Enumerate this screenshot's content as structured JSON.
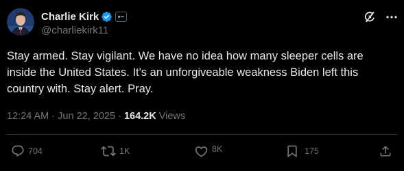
{
  "author": {
    "display_name": "Charlie Kirk",
    "handle": "@charliekirk11"
  },
  "post": {
    "lines": [
      "Stay armed. Stay vigilant. We have no idea how many sleeper cells are",
      "inside the United States. It's an unforgiveable weakness Biden left this",
      "country with. Stay alert. Pray."
    ],
    "time": "12:24 AM",
    "separator_1": "·",
    "date": "Jun 22, 2025",
    "separator_2": "·",
    "views_count": "164.2K",
    "views_label": "Views"
  },
  "actions": {
    "replies": "704",
    "reposts": "1K",
    "likes": "8K",
    "bookmarks": "175"
  },
  "icons": {
    "verified": "verified-badge-icon",
    "affiliation": "affiliation-badge-icon",
    "grok": "grok-icon",
    "more": "more-options-icon",
    "reply": "reply-icon",
    "repost": "repost-icon",
    "like": "heart-icon",
    "bookmark": "bookmark-icon",
    "share": "share-icon"
  },
  "colors": {
    "background": "#000000",
    "text_primary": "#e7e9ea",
    "text_secondary": "#71767b",
    "verified_blue": "#1d9bf0",
    "divider": "#2f3336"
  }
}
